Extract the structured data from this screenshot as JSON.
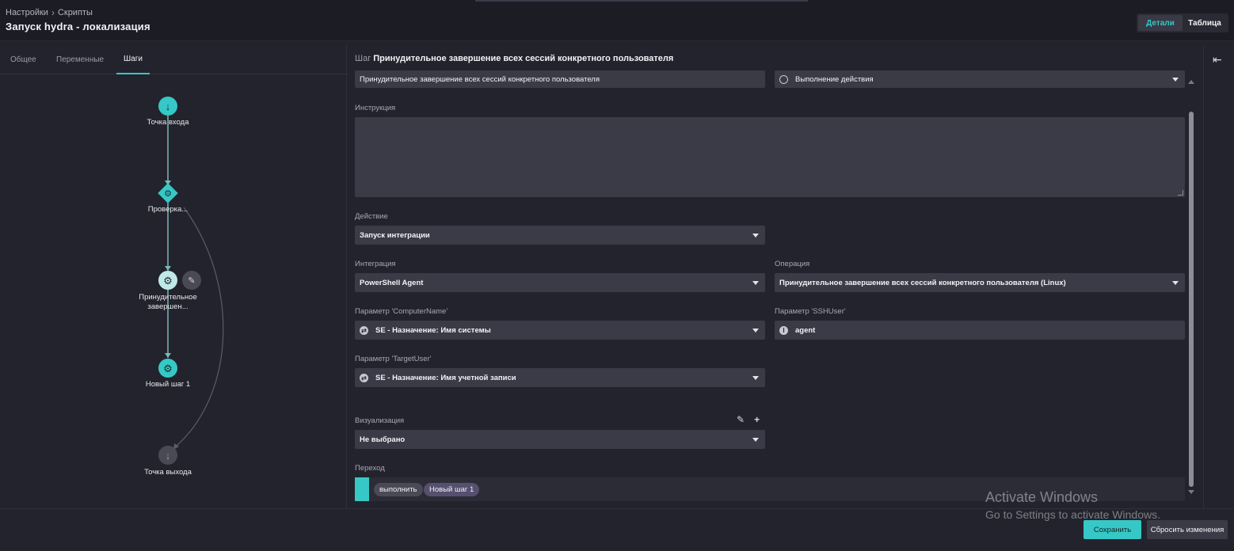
{
  "header": {
    "breadcrumb": [
      "Настройки",
      "Скрипты"
    ],
    "title": "Запуск hydra - локализация",
    "view_tabs": [
      "Детали",
      "Таблица"
    ]
  },
  "left": {
    "tabs": [
      "Общее",
      "Переменные",
      "Шаги"
    ],
    "nodes": {
      "entry": "Точка входа",
      "check": "Проверка...",
      "forced_line1": "Принудительное",
      "forced_line2": "завершен...",
      "new_step": "Новый шаг 1",
      "exit": "Точка выхода"
    }
  },
  "step": {
    "prefix": "Шаг",
    "title": "Принудительное завершение всех сессий конкретного пользователя",
    "name_value": "Принудительное завершение всех сессий конкретного пользователя",
    "type_value": "Выполнение действия",
    "instruction_label": "Инструкция",
    "action_label": "Действие",
    "action_value": "Запуск интеграции",
    "integration_label": "Интеграция",
    "integration_value": "PowerShell Agent",
    "operation_label": "Операция",
    "operation_value": "Принудительное завершение всех сессий конкретного пользователя (Linux)",
    "param_computer_label": "Параметр 'ComputerName'",
    "param_computer_value": "SE - Назначение: Имя системы",
    "param_sshuser_label": "Параметр 'SSHUser'",
    "param_sshuser_value": "agent",
    "param_target_label": "Параметр 'TargetUser'",
    "param_target_value": "SE - Назначение: Имя учетной записи",
    "visualization_label": "Визуализация",
    "visualization_value": "Не выбрано",
    "transition_label": "Переход",
    "transition_pill_action": "выполнить",
    "transition_pill_target": "Новый шаг 1"
  },
  "footer": {
    "save": "Сохранить",
    "reset": "Сбросить изменения"
  },
  "watermark": {
    "line1": "Activate Windows",
    "line2": "Go to Settings to activate Windows."
  },
  "colors": {
    "accent": "#35c8c6",
    "background": "#23232d",
    "field": "#3b3b47"
  }
}
